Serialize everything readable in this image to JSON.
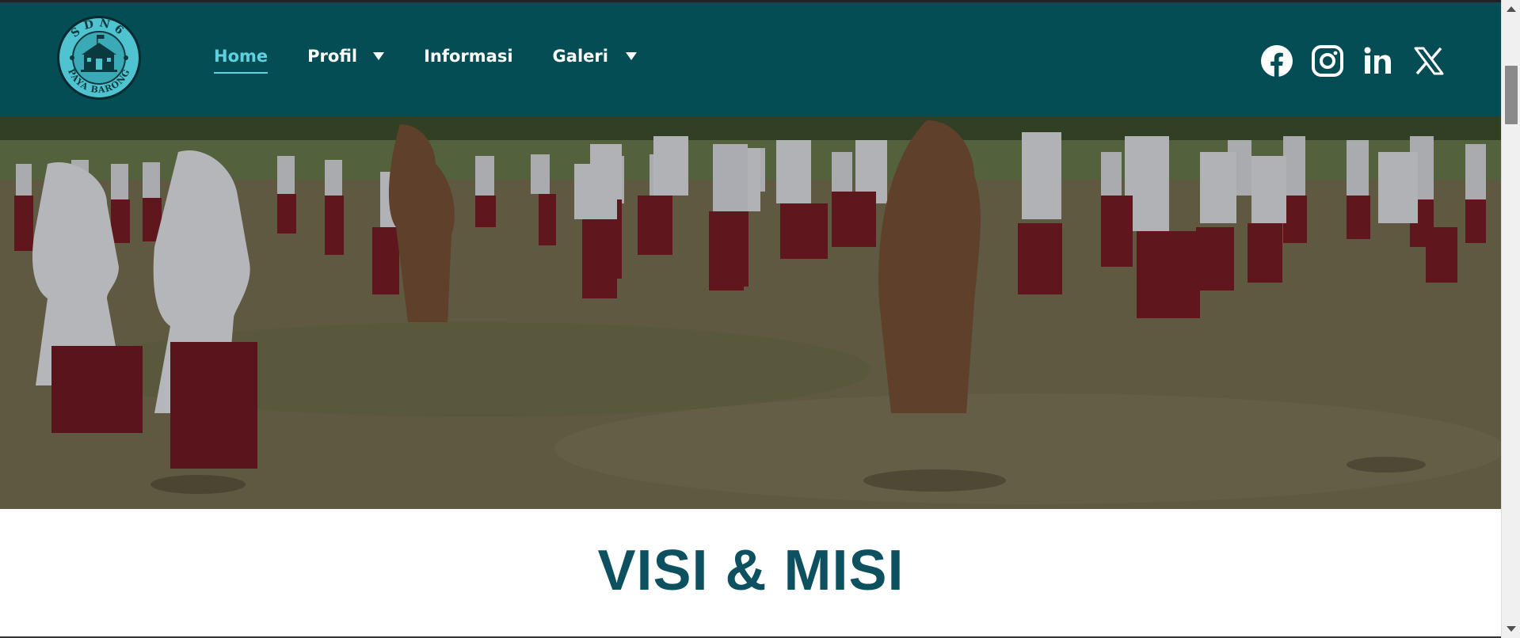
{
  "header": {
    "logo": {
      "top_text": "SDN6",
      "bottom_text": "PAYA BARONG",
      "ring_color": "#4fc3cf"
    },
    "nav": [
      {
        "label": "Home",
        "active": true,
        "dropdown": false
      },
      {
        "label": "Profil",
        "active": false,
        "dropdown": true
      },
      {
        "label": "Informasi",
        "active": false,
        "dropdown": false
      },
      {
        "label": "Galeri",
        "active": false,
        "dropdown": true
      }
    ],
    "socials": [
      "facebook-icon",
      "instagram-icon",
      "linkedin-icon",
      "x-icon"
    ],
    "background": "#054d55",
    "active_color": "#5fd1de"
  },
  "hero": {
    "image": "photo of students in white and maroon uniforms doing morning exercise on a grass field"
  },
  "section": {
    "title": "VISI & MISI",
    "title_color": "#0d5060"
  }
}
